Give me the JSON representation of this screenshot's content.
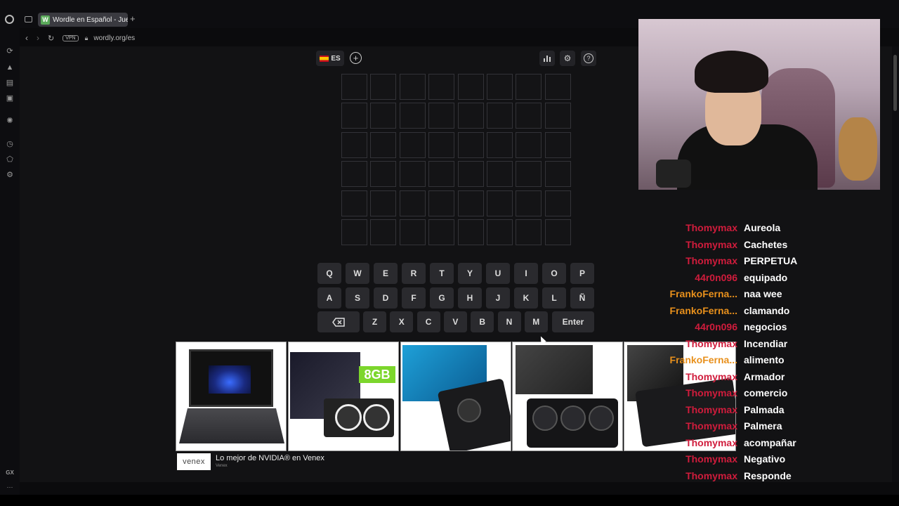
{
  "browser": {
    "tab_title": "Wordle en Español - Juego",
    "favicon_letter": "W",
    "new_tab": "+",
    "url": "wordly.org/es",
    "vpn_label": "VPN",
    "gx_label": "GX",
    "more_label": "···"
  },
  "game": {
    "language": "ES",
    "grid": {
      "rows": 6,
      "cols": 8
    },
    "keyboard": {
      "row1": [
        "Q",
        "W",
        "E",
        "R",
        "T",
        "Y",
        "U",
        "I",
        "O",
        "P"
      ],
      "row2": [
        "A",
        "S",
        "D",
        "F",
        "G",
        "H",
        "J",
        "K",
        "L",
        "Ñ"
      ],
      "row3": [
        "Z",
        "X",
        "C",
        "V",
        "B",
        "N",
        "M"
      ],
      "enter_label": "Enter",
      "backspace_icon": "backspace-icon"
    }
  },
  "ad": {
    "title": "Lo mejor de NVIDIA® en Venex",
    "source": "Venex",
    "logo": "venex",
    "badge_8gb": "8GB",
    "products": [
      "laptop",
      "galax-gpu",
      "gigabyte-gpu",
      "asus-prime-gpu",
      "gpu"
    ]
  },
  "chat": [
    {
      "user": "Thomymax",
      "msg": "Aureola",
      "color": "#d01c3c"
    },
    {
      "user": "Thomymax",
      "msg": "Cachetes",
      "color": "#d01c3c"
    },
    {
      "user": "Thomymax",
      "msg": "PERPETUA",
      "color": "#d01c3c"
    },
    {
      "user": "44r0n096",
      "msg": "equipado",
      "color": "#d01c3c"
    },
    {
      "user": "FrankoFerna...",
      "msg": "naa wee",
      "color": "#e8901c"
    },
    {
      "user": "FrankoFerna...",
      "msg": "clamando",
      "color": "#e8901c"
    },
    {
      "user": "44r0n096",
      "msg": "negocios",
      "color": "#d01c3c"
    },
    {
      "user": "Thomymax",
      "msg": "Incendiar",
      "color": "#d01c3c"
    },
    {
      "user": "FrankoFerna...",
      "msg": "alimento",
      "color": "#e8901c"
    },
    {
      "user": "Thomymax",
      "msg": "Armador",
      "color": "#d01c3c"
    },
    {
      "user": "Thomymax",
      "msg": "comercio",
      "color": "#d01c3c"
    },
    {
      "user": "Thomymax",
      "msg": "Palmada",
      "color": "#d01c3c"
    },
    {
      "user": "Thomymax",
      "msg": "Palmera",
      "color": "#d01c3c"
    },
    {
      "user": "Thomymax",
      "msg": "acompañar",
      "color": "#d01c3c"
    },
    {
      "user": "Thomymax",
      "msg": "Negativo",
      "color": "#d01c3c"
    },
    {
      "user": "Thomymax",
      "msg": "Responde",
      "color": "#d01c3c"
    }
  ]
}
